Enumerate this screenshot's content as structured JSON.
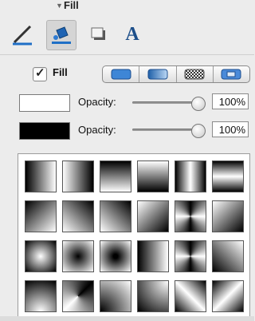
{
  "panel": {
    "section_title": "Fill"
  },
  "toolbar": {
    "tools": [
      {
        "icon": "pen-icon",
        "selected": false
      },
      {
        "icon": "paint-bucket-icon",
        "selected": true
      },
      {
        "icon": "shadow-box-icon",
        "selected": false
      },
      {
        "icon": "text-A-icon",
        "selected": false,
        "glyph": "A"
      }
    ]
  },
  "fill": {
    "checkbox_label": "Fill",
    "checked": true,
    "styles": [
      {
        "icon": "solid-fill-icon"
      },
      {
        "icon": "gradient-fill-icon"
      },
      {
        "icon": "pattern-fill-icon"
      },
      {
        "icon": "image-fill-icon"
      }
    ]
  },
  "rows": [
    {
      "label": "Opacity:",
      "value": "100%",
      "level": 1.0,
      "color": "#ffffff"
    },
    {
      "label": "Opacity:",
      "value": "100%",
      "level": 1.0,
      "color": "#000000"
    }
  ],
  "gradients": {
    "tiles": [
      "linear-gradient(90deg,#000,#fff)",
      "linear-gradient(270deg,#000,#fff)",
      "linear-gradient(180deg,#000,#fff)",
      "linear-gradient(0deg,#000,#fff)",
      "linear-gradient(90deg,#000,#fff 50%,#000)",
      "linear-gradient(180deg,#000,#fff 50%,#000)",
      "linear-gradient(135deg,#000,#fff)",
      "linear-gradient(45deg,#fff,#000)",
      "linear-gradient(225deg,#000,#fff)",
      "linear-gradient(315deg,#000,#fff)",
      "conic-gradient(#000,#fff,#000,#fff,#000)",
      "linear-gradient(135deg,#fff,#000)",
      "radial-gradient(circle,#fff,#000)",
      "radial-gradient(circle,#000,#fff)",
      "radial-gradient(circle,#000 10%,#fff)",
      "linear-gradient(90deg,#000,#fff)",
      "conic-gradient(#000,#fff 90deg,#000 180deg,#fff 270deg,#000)",
      "linear-gradient(45deg,#000,#fff)",
      "radial-gradient(circle at 50% 100%,#fff,#000)",
      "conic-gradient(from 45deg,#000,#fff,#000)",
      "radial-gradient(circle at 0 100%,#000,#fff)",
      "radial-gradient(circle at 100% 0,#fff,#000)",
      "linear-gradient(45deg,#000,#fff 50%,#000)",
      "linear-gradient(135deg,#000,#fff 50%,#000)"
    ]
  },
  "colors": {
    "accent": "#3875d7",
    "panel_bg": "#ececec"
  }
}
